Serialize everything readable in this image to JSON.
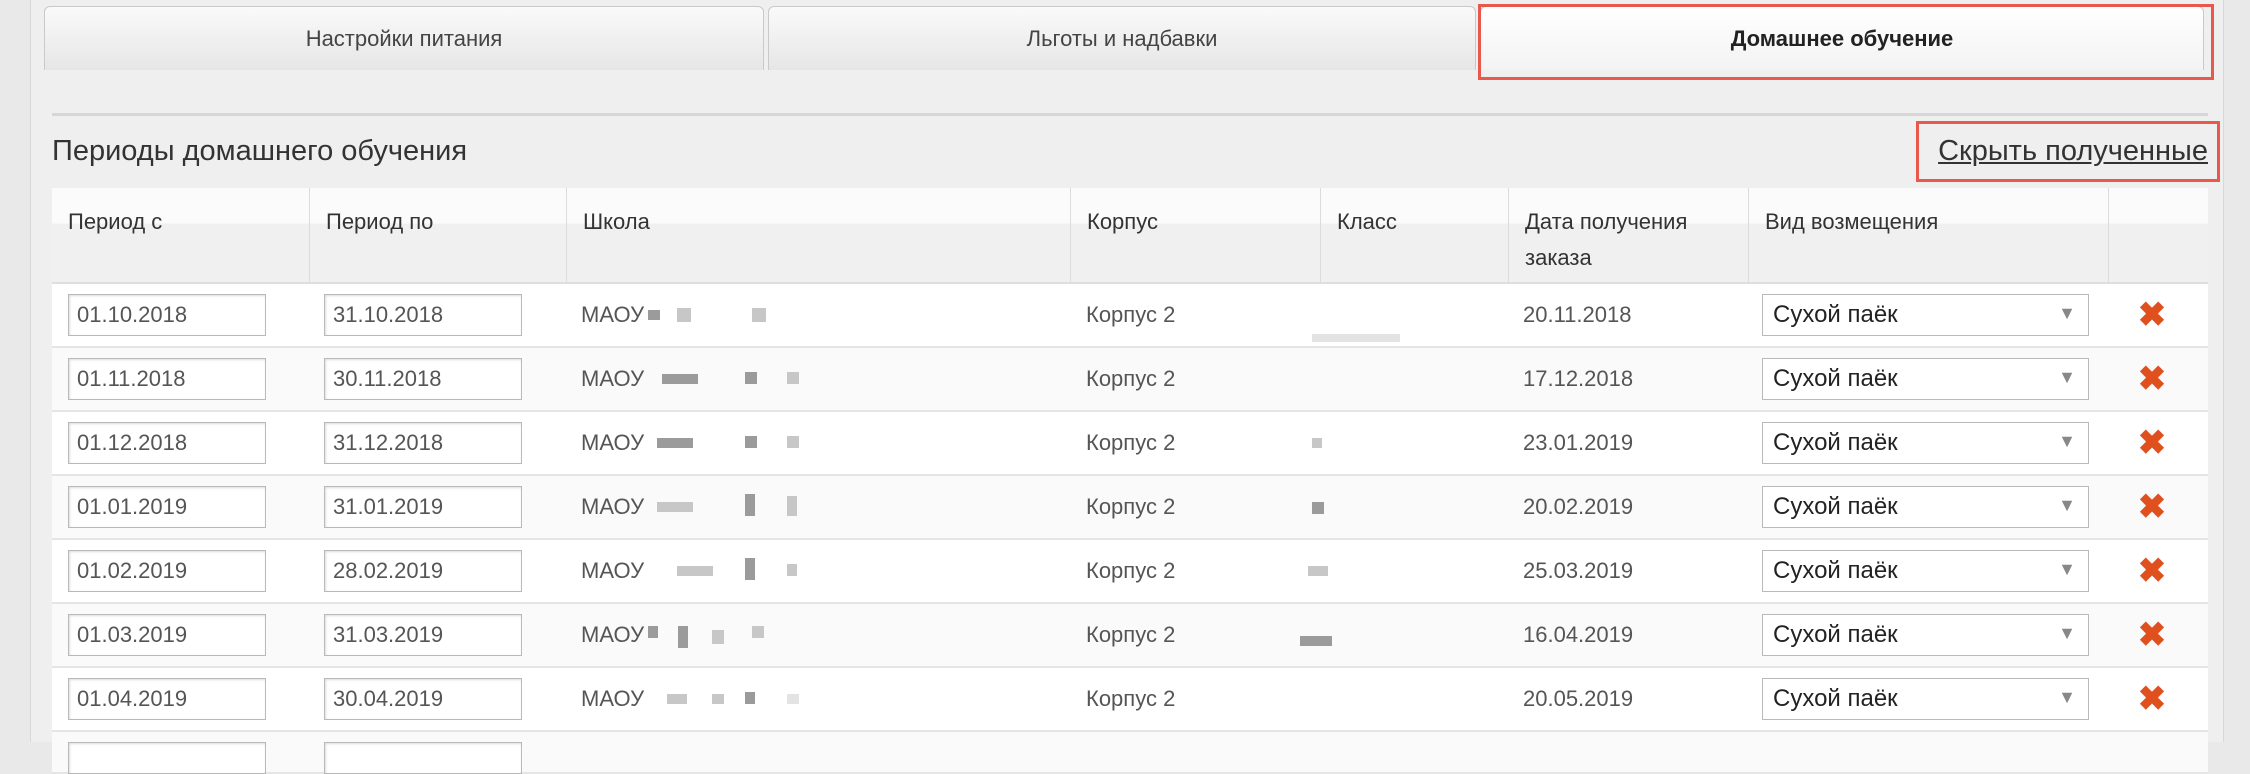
{
  "tabs": [
    {
      "label": "Настройки питания",
      "active": false
    },
    {
      "label": "Льготы и надбавки",
      "active": false
    },
    {
      "label": "Домашнее обучение",
      "active": true
    }
  ],
  "section": {
    "title": "Периоды домашнего обучения",
    "hide_link": "Скрыть полученные"
  },
  "table": {
    "headers": {
      "period_from": "Период с",
      "period_to": "Период по",
      "school": "Школа",
      "building": "Корпус",
      "class": "Класс",
      "order_date_line1": "Дата получения",
      "order_date_line2": "заказа",
      "compensation": "Вид возмещения"
    },
    "rows": [
      {
        "from": "01.10.2018",
        "to": "31.10.2018",
        "school": "МАОУ",
        "building": "Корпус 2",
        "date": "20.11.2018",
        "type": "Сухой паёк"
      },
      {
        "from": "01.11.2018",
        "to": "30.11.2018",
        "school": "МАОУ",
        "building": "Корпус 2",
        "date": "17.12.2018",
        "type": "Сухой паёк"
      },
      {
        "from": "01.12.2018",
        "to": "31.12.2018",
        "school": "МАОУ",
        "building": "Корпус 2",
        "date": "23.01.2019",
        "type": "Сухой паёк"
      },
      {
        "from": "01.01.2019",
        "to": "31.01.2019",
        "school": "МАОУ",
        "building": "Корпус 2",
        "date": "20.02.2019",
        "type": "Сухой паёк"
      },
      {
        "from": "01.02.2019",
        "to": "28.02.2019",
        "school": "МАОУ",
        "building": "Корпус 2",
        "date": "25.03.2019",
        "type": "Сухой паёк"
      },
      {
        "from": "01.03.2019",
        "to": "31.03.2019",
        "school": "МАОУ",
        "building": "Корпус 2",
        "date": "16.04.2019",
        "type": "Сухой паёк"
      },
      {
        "from": "01.04.2019",
        "to": "30.04.2019",
        "school": "МАОУ",
        "building": "Корпус 2",
        "date": "20.05.2019",
        "type": "Сухой паёк"
      }
    ]
  },
  "icons": {
    "delete": "close-icon",
    "dropdown": "chevron-down-icon"
  },
  "colors": {
    "highlight": "#e8584d",
    "delete": "#e0501e"
  }
}
